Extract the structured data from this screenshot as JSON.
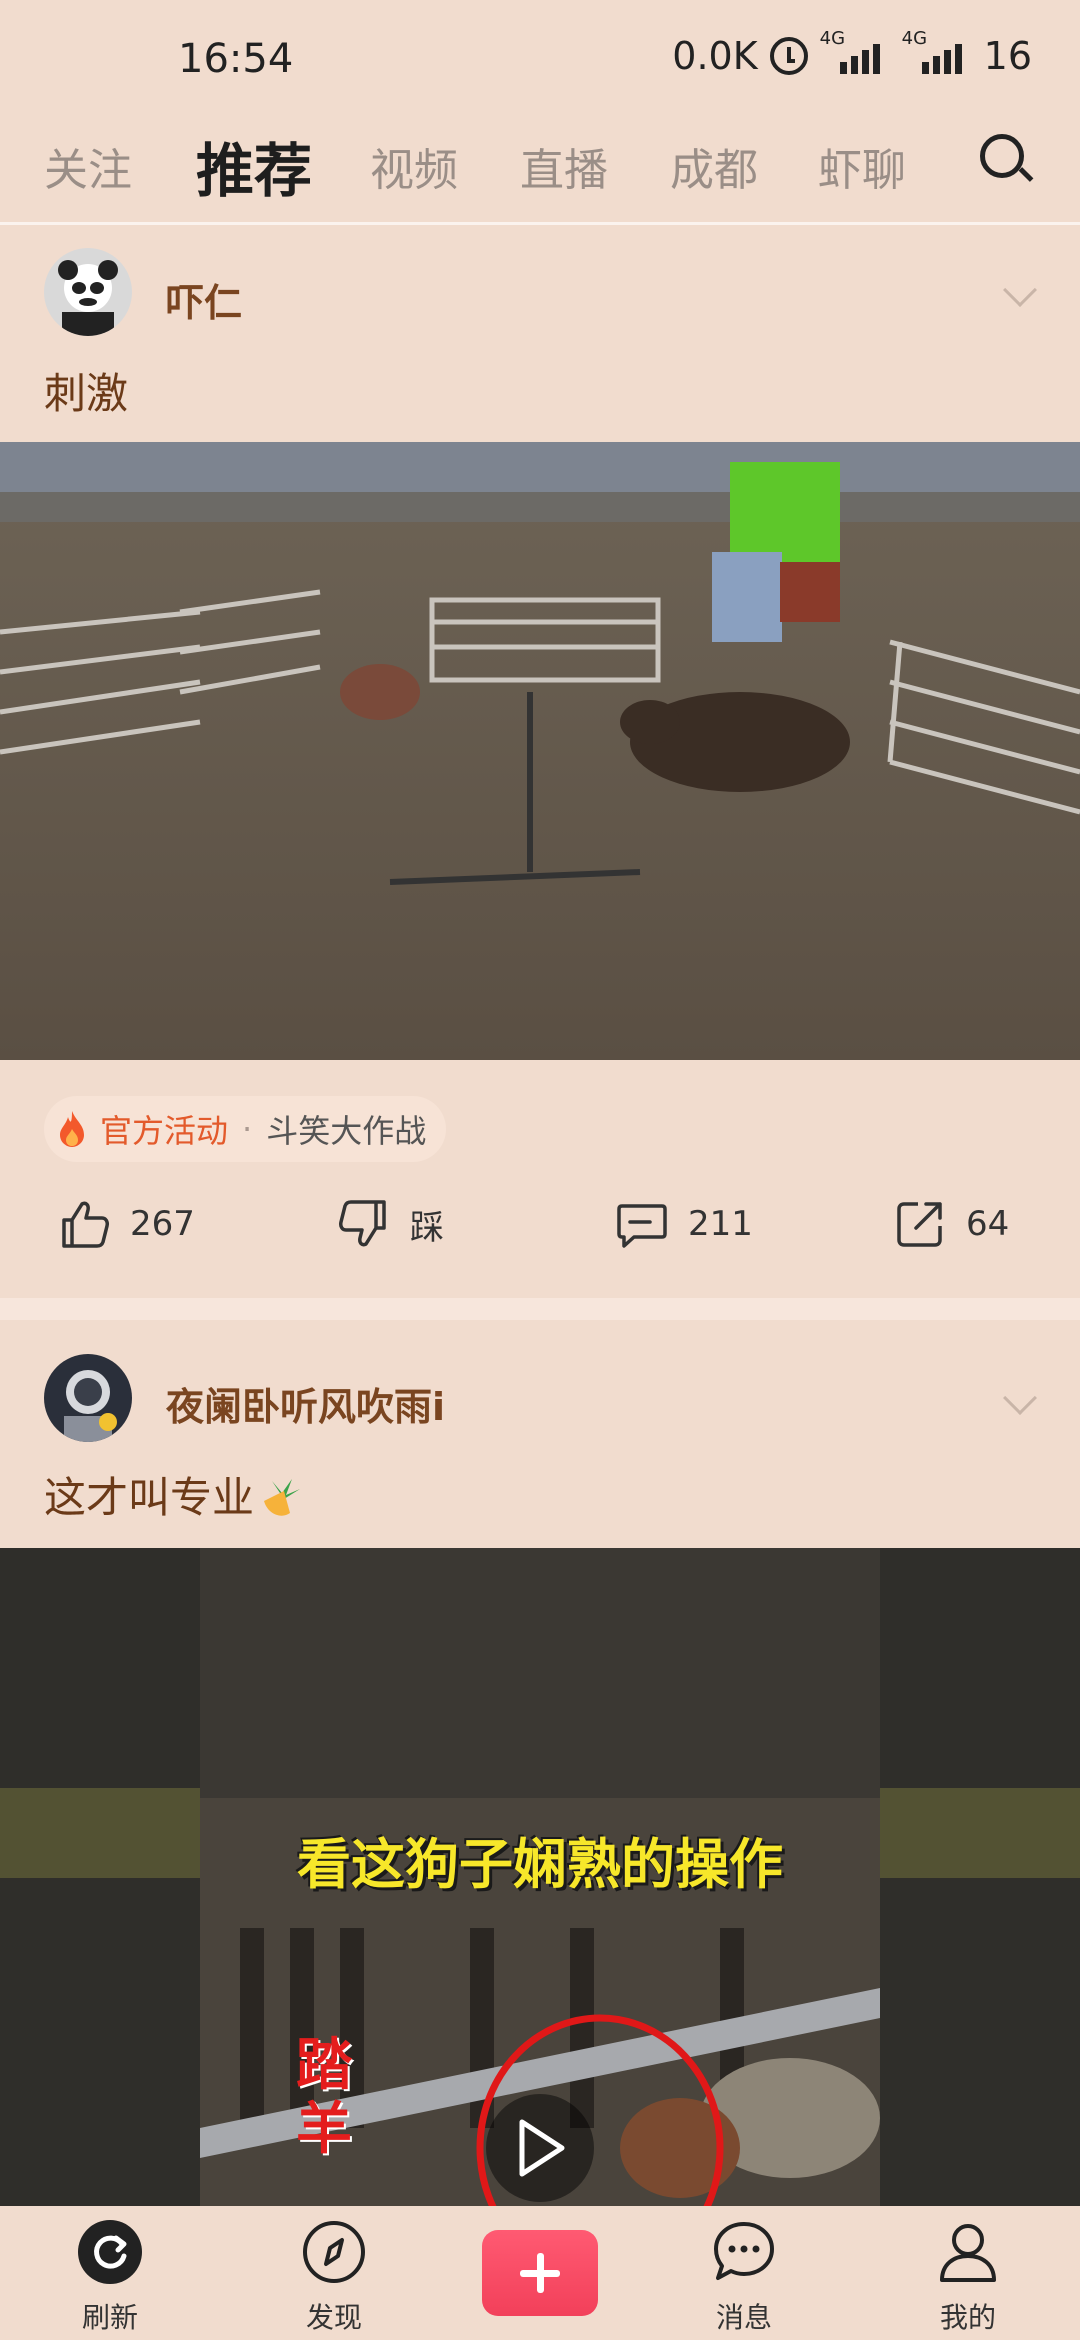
{
  "status_bar": {
    "time": "16:54",
    "net_speed": "0.0K",
    "signal1_label": "4G",
    "signal2_label": "4G",
    "battery": "16"
  },
  "top_tabs": {
    "items": [
      "关注",
      "推荐",
      "视频",
      "直播",
      "成都",
      "虾聊"
    ],
    "active": "推荐"
  },
  "posts": [
    {
      "author": "吓仁",
      "caption": "刺激",
      "activity": {
        "label": "官方活动",
        "separator": "·",
        "name": "斗笑大作战"
      },
      "likes": "267",
      "dislike_label": "踩",
      "comments": "211",
      "shares": "64"
    },
    {
      "author": "夜阑卧听风吹雨i",
      "caption": "这才叫专业",
      "video_overlay_text": "看这狗子娴熟的操作",
      "video_side_text": "踏羊"
    }
  ],
  "bottom_nav": {
    "refresh": "刷新",
    "discover": "发现",
    "messages": "消息",
    "mine": "我的"
  },
  "colors": {
    "background": "#f1dcce",
    "author": "#7a4520",
    "accent_red": "#f2405a",
    "activity_orange": "#e35a2b"
  }
}
